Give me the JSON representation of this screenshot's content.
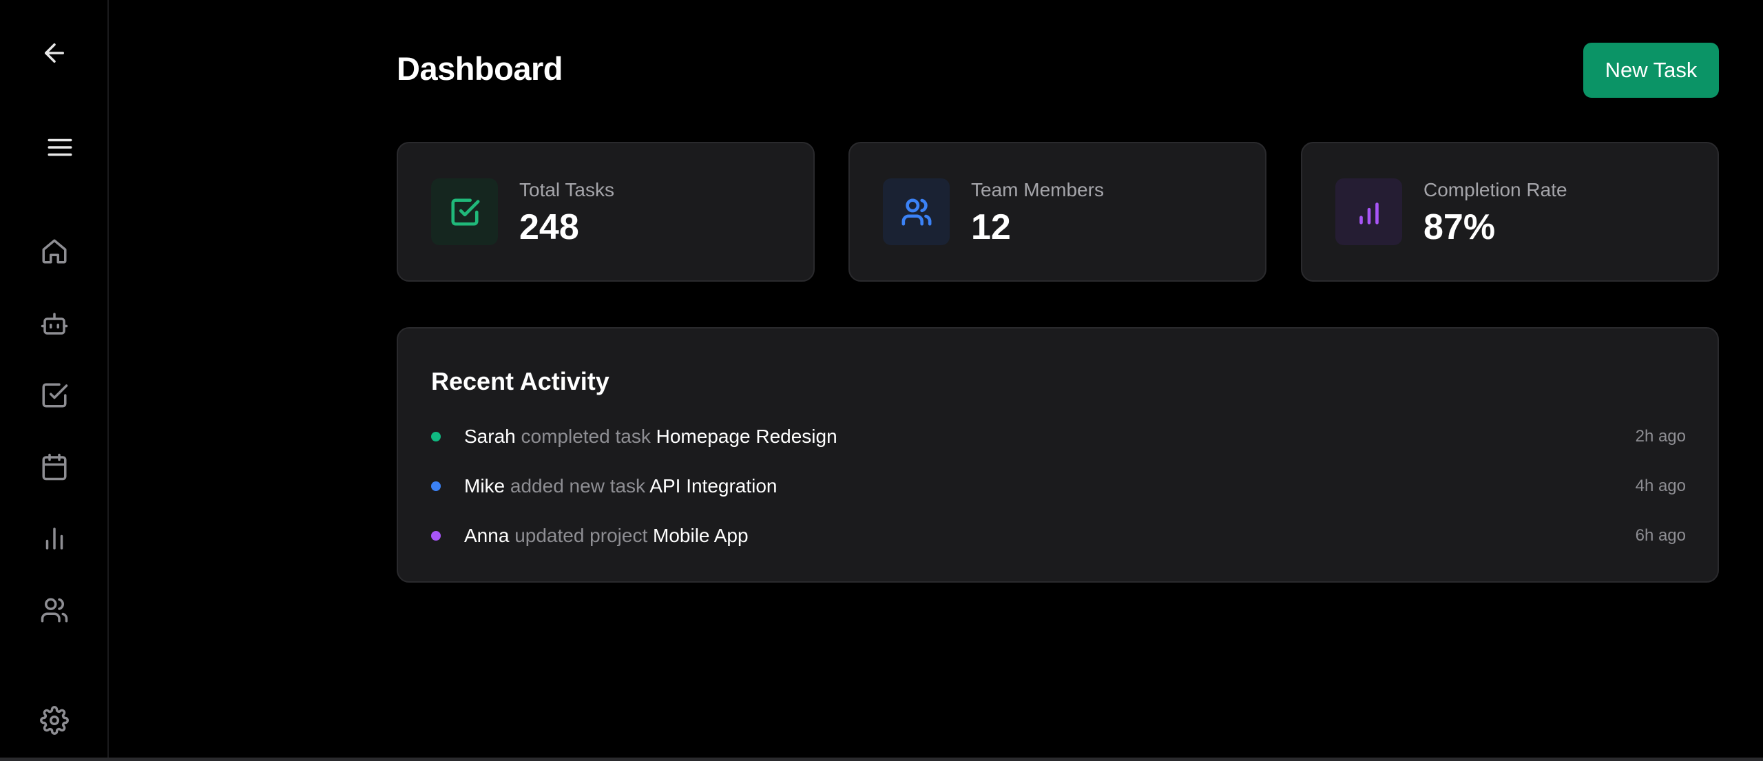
{
  "header": {
    "title": "Dashboard",
    "new_task_label": "New Task"
  },
  "sidebar": {
    "items": [
      {
        "icon": "arrow-left-icon"
      },
      {
        "icon": "menu-icon"
      },
      {
        "icon": "home-icon"
      },
      {
        "icon": "bot-icon"
      },
      {
        "icon": "check-square-icon"
      },
      {
        "icon": "calendar-icon"
      },
      {
        "icon": "bar-chart-icon"
      },
      {
        "icon": "users-icon"
      },
      {
        "icon": "gear-icon"
      }
    ]
  },
  "stats": [
    {
      "label": "Total Tasks",
      "value": "248",
      "icon": "check-square-icon",
      "color": "#20b97a",
      "bg": "#15261f"
    },
    {
      "label": "Team Members",
      "value": "12",
      "icon": "users-icon",
      "color": "#3b82f6",
      "bg": "#1a2233"
    },
    {
      "label": "Completion Rate",
      "value": "87%",
      "icon": "bar-chart-icon",
      "color": "#a855f7",
      "bg": "#251d33"
    }
  ],
  "activity": {
    "title": "Recent Activity",
    "items": [
      {
        "user": "Sarah",
        "action": "completed task",
        "target": "Homepage Redesign",
        "time": "2h ago",
        "color": "#10b981"
      },
      {
        "user": "Mike",
        "action": "added new task",
        "target": "API Integration",
        "time": "4h ago",
        "color": "#3b82f6"
      },
      {
        "user": "Anna",
        "action": "updated project",
        "target": "Mobile App",
        "time": "6h ago",
        "color": "#a855f7"
      }
    ]
  },
  "colors": {
    "accent": "#0b9466",
    "background": "#000000",
    "card": "#1b1b1d"
  }
}
